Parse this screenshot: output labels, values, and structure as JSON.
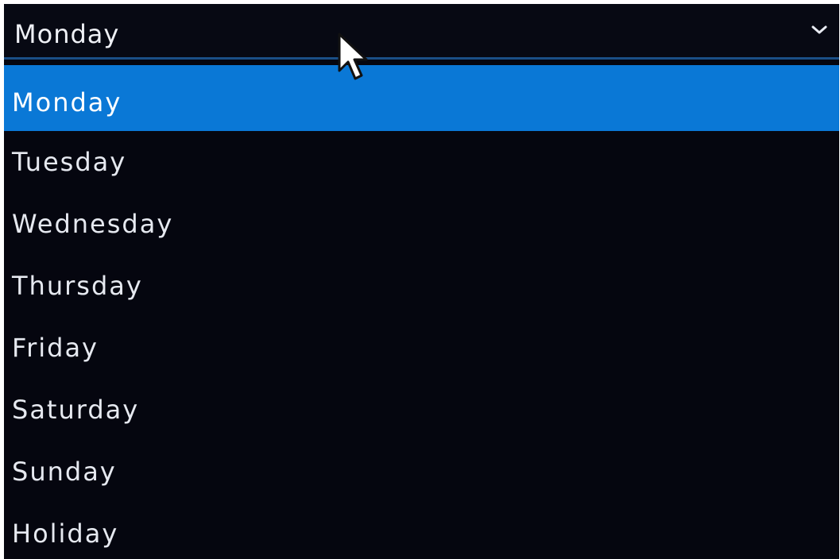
{
  "select": {
    "selected_value": "Monday",
    "icon": "chevron-down-icon"
  },
  "options": [
    {
      "label": "Monday",
      "selected": true
    },
    {
      "label": "Tuesday",
      "selected": false
    },
    {
      "label": "Wednesday",
      "selected": false
    },
    {
      "label": "Thursday",
      "selected": false
    },
    {
      "label": "Friday",
      "selected": false
    },
    {
      "label": "Saturday",
      "selected": false
    },
    {
      "label": "Sunday",
      "selected": false
    },
    {
      "label": "Holiday",
      "selected": false
    }
  ],
  "colors": {
    "background": "#05060f",
    "highlight": "#0a78d6",
    "border_accent": "#1a4f86",
    "text": "#e6e9f0"
  },
  "cursor": {
    "icon": "mouse-pointer-icon"
  }
}
